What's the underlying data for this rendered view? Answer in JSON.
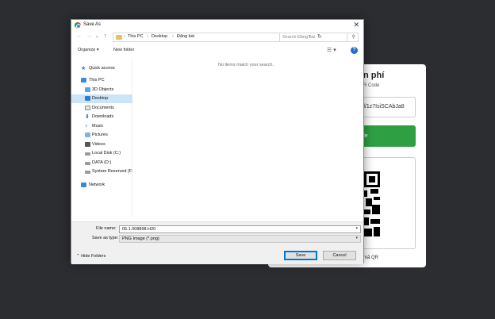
{
  "background_page": {
    "title_partial": "n phí",
    "subtitle_partial": "R Code",
    "input_partial": "d/1z7IsiSCAbJa8",
    "button_partial": "ode",
    "qr_label_partial": "mã QR"
  },
  "dialog": {
    "title": "Save As",
    "close": "✕",
    "breadcrumbs": [
      "This PC",
      "Desktop",
      "Đăng bài"
    ],
    "search_placeholder": "Search Đăng bài",
    "toolbar": {
      "organize": "Organize ▾",
      "new_folder": "New folder"
    },
    "empty_message": "No items match your search.",
    "nav": {
      "quick_access": "Quick access",
      "this_pc": "This PC",
      "objects_3d": "3D Objects",
      "desktop": "Desktop",
      "documents": "Documents",
      "downloads": "Downloads",
      "music": "Music",
      "pictures": "Pictures",
      "videos": "Videos",
      "local_disk": "Local Disk (C:)",
      "data_disk": "DATA (D:)",
      "system_reserved": "System Reserved (F:",
      "network": "Network"
    },
    "file_name_label": "File name:",
    "file_name_value": "05.1.008898.H20",
    "save_type_label": "Save as type:",
    "save_type_value": "PNG Image (*.png)",
    "hide_folders": "Hide Folders",
    "save_button": "Save",
    "cancel_button": "Cancel"
  }
}
